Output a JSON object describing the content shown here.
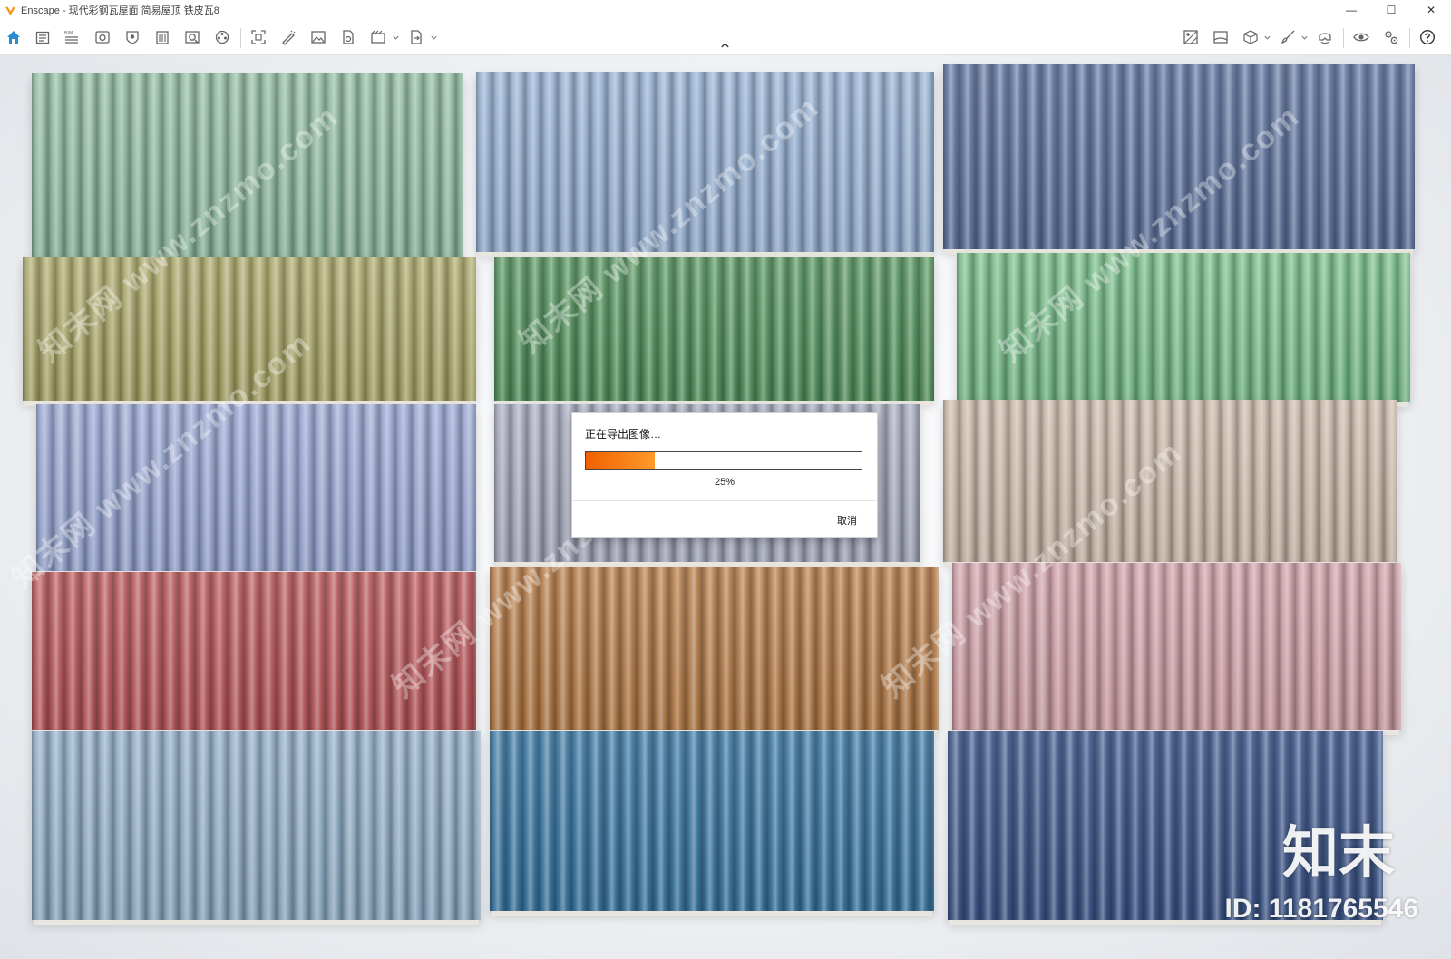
{
  "window": {
    "title": "Enscape - 现代彩钢瓦屋面 简易屋顶 铁皮瓦8",
    "controls": [
      "—",
      "☐",
      "✕"
    ]
  },
  "toolbar": {
    "left_icons": [
      "home-icon",
      "project-icon",
      "bim-icon",
      "view-icon",
      "atmosphere-icon",
      "building-icon",
      "asset-library-icon",
      "material-icon",
      "screenshot-icon",
      "draw-icon",
      "image-icon",
      "document-icon",
      "video-icon",
      "export-icon"
    ],
    "right_icons": [
      "site-context-icon",
      "panorama-icon",
      "cube-icon",
      "brush-icon",
      "vr-icon",
      "visibility-icon",
      "settings-icon",
      "help-icon"
    ]
  },
  "colors": {
    "accent": "#2a8dd4",
    "progress_start": "#f06000",
    "progress_end": "#ff9a2a"
  },
  "scene": {
    "panels": [
      {
        "name": "sage-green",
        "color": "#8fb8a0"
      },
      {
        "name": "steel-blue",
        "color": "#95afd0"
      },
      {
        "name": "slate-blue",
        "color": "#5e739c"
      },
      {
        "name": "olive",
        "color": "#a9a66a"
      },
      {
        "name": "forest-green",
        "color": "#56925f"
      },
      {
        "name": "mint-green",
        "color": "#78bb88"
      },
      {
        "name": "periwinkle",
        "color": "#98a6d0"
      },
      {
        "name": "lavender-grey",
        "color": "#a5a9bc"
      },
      {
        "name": "beige",
        "color": "#c9b8a8"
      },
      {
        "name": "brick-red",
        "color": "#b7585a"
      },
      {
        "name": "copper-brown",
        "color": "#b27a48"
      },
      {
        "name": "dusty-pink",
        "color": "#cc9ea6"
      },
      {
        "name": "pale-blue",
        "color": "#8fabc4"
      },
      {
        "name": "ocean-blue",
        "color": "#3b76a0"
      },
      {
        "name": "navy",
        "color": "#3d5688"
      }
    ],
    "watermark_text": "知末网 www.znzmo.com",
    "brand_text": "知末",
    "id_text": "ID: 1181765546"
  },
  "dialog": {
    "title": "正在导出图像…",
    "progress": 0.25,
    "percent_label": "25%",
    "cancel_label": "取消"
  }
}
